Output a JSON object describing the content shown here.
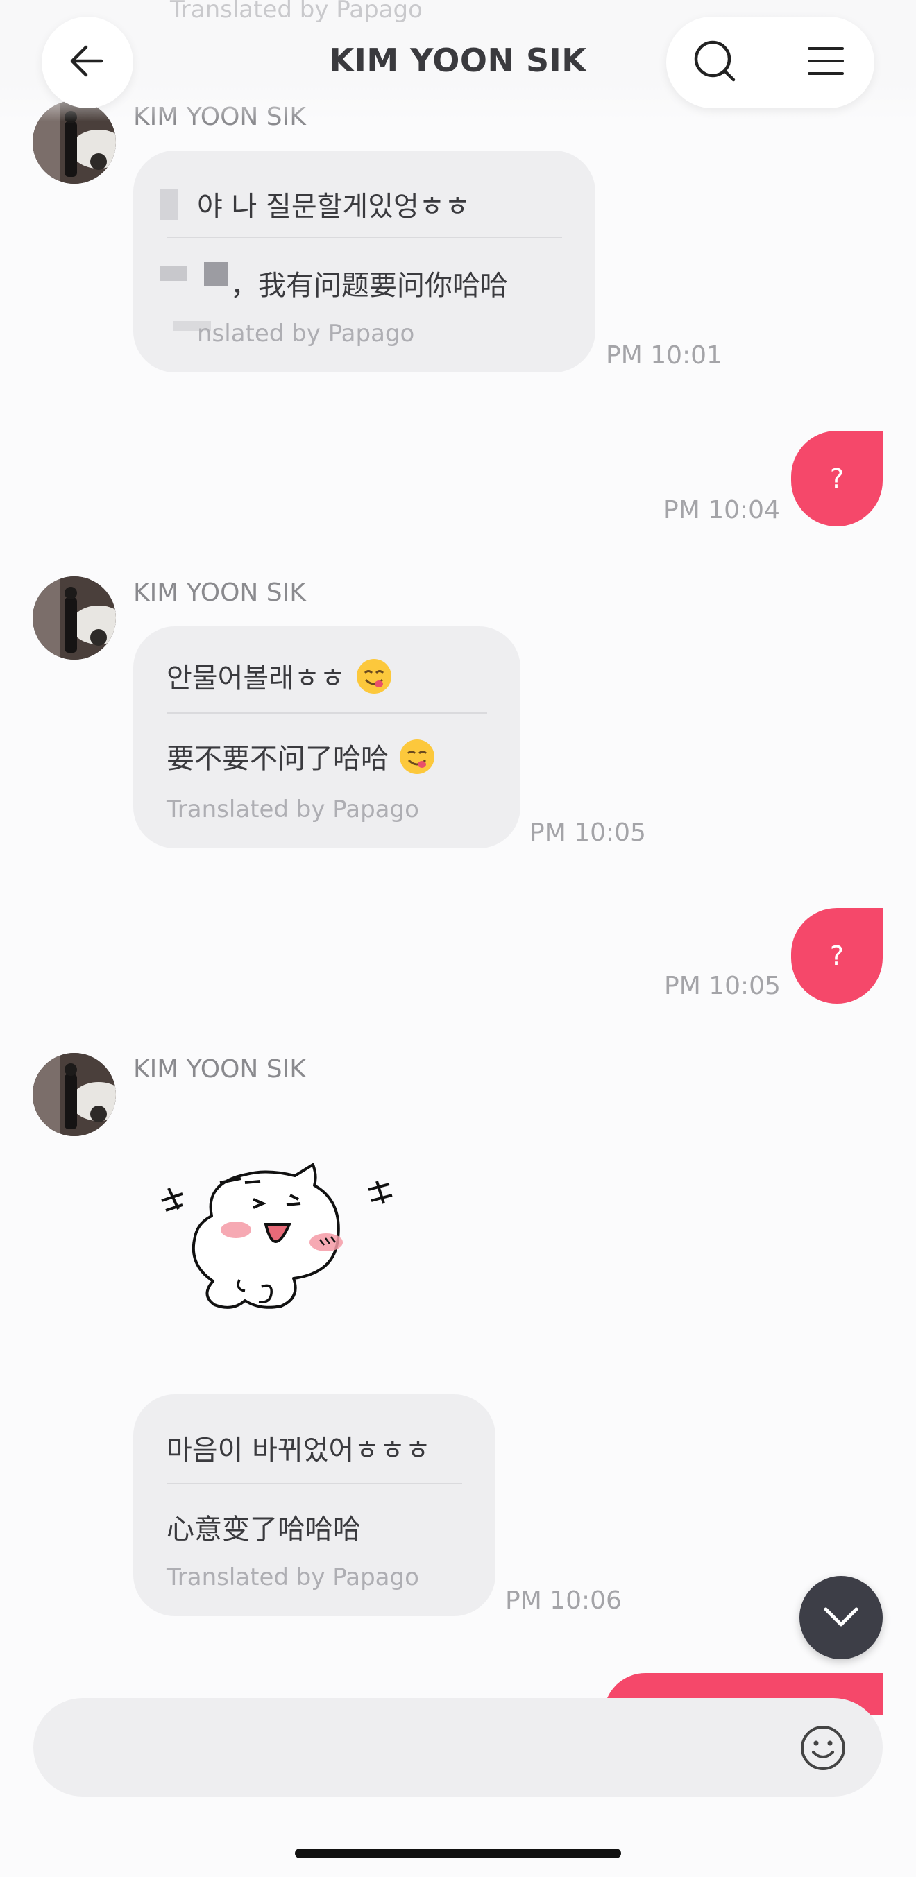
{
  "header": {
    "title": "KIM YOON SIK",
    "ghost_text": "Translated by Papago"
  },
  "messages": [
    {
      "sender": "KIM YOON SIK",
      "original": "야 나 질문할게있엉ㅎㅎ",
      "translated": "，我有问题要问你哈哈",
      "translation_note": "nslated by Papago",
      "time": "PM 10:01"
    },
    {
      "outgoing_text": "?",
      "time": "PM 10:04"
    },
    {
      "sender": "KIM YOON SIK",
      "original": "안물어볼래ㅎㅎ",
      "translated": "要不要不问了哈哈",
      "translation_note": "Translated by Papago",
      "time": "PM 10:05"
    },
    {
      "outgoing_text": "?",
      "time": "PM 10:05"
    },
    {
      "sender": "KIM YOON SIK",
      "sticker": "happy-cat-sticker",
      "original": "마음이 바뀌었어ㅎㅎㅎ",
      "translated": "心意变了哈哈哈",
      "translation_note": "Translated by Papago",
      "time": "PM 10:06"
    }
  ],
  "colors": {
    "outgoing_bubble": "#f5486a",
    "incoming_bubble": "#eeeef0",
    "scroll_button": "#3d3e47"
  },
  "icons": [
    "back-arrow-icon",
    "search-icon",
    "menu-icon",
    "emoji-smile-icon",
    "chevron-down-icon"
  ]
}
